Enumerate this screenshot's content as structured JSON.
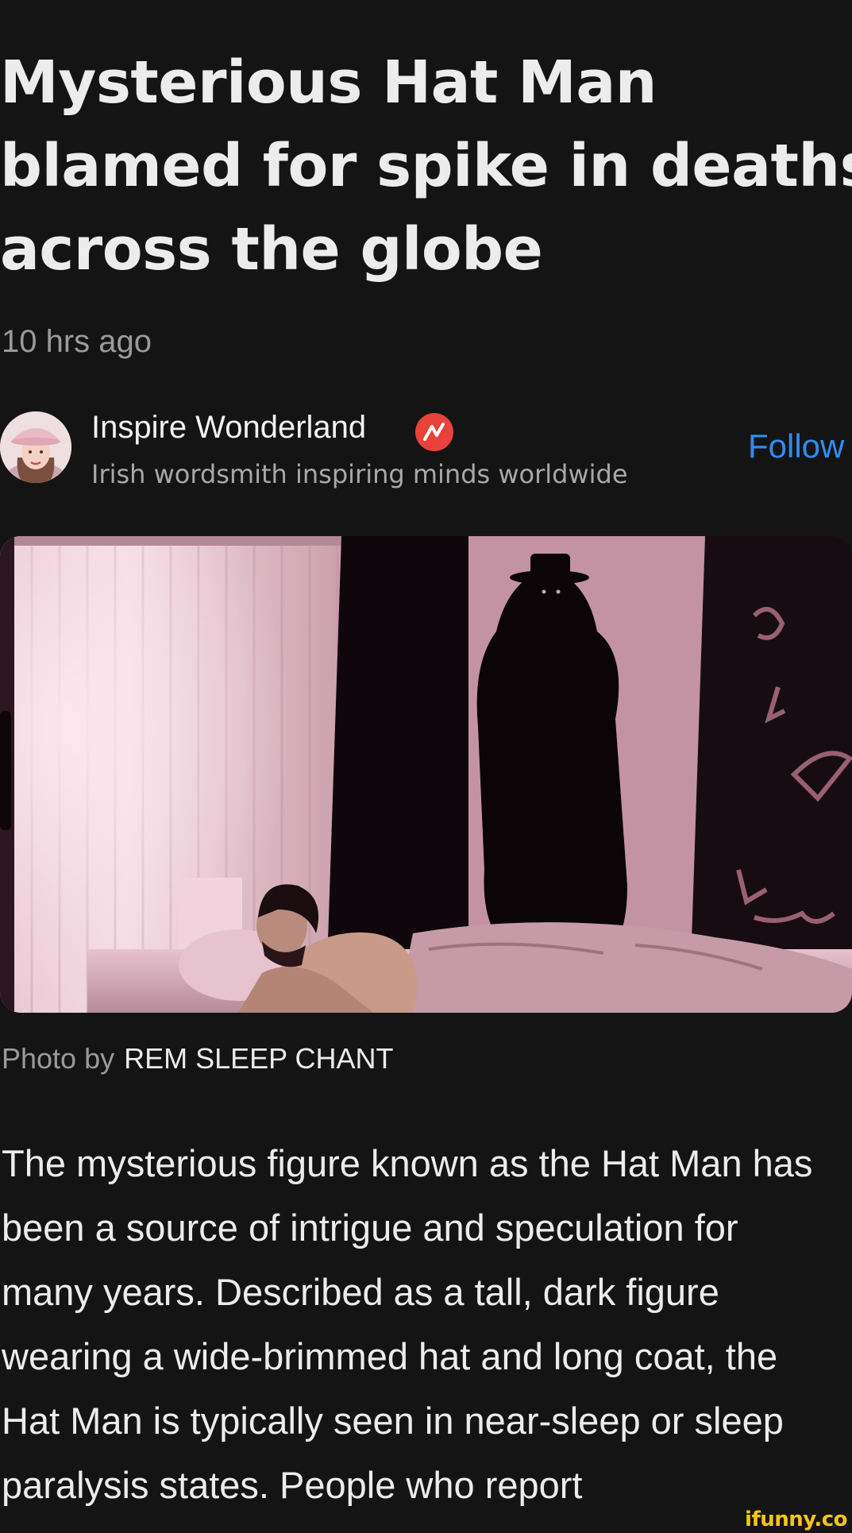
{
  "article": {
    "headline_lines": [
      "Mysterious Hat Man",
      "blamed for spike in deaths",
      "across the globe"
    ],
    "timestamp": "10 hrs ago"
  },
  "author": {
    "name": "Inspire Wonderland",
    "tagline": "Irish wordsmith inspiring minds worldwide",
    "follow_label": "Follow",
    "badge_icon": "verified-badge-icon",
    "badge_color": "#e8423a"
  },
  "photo": {
    "credit_label": "Photo by",
    "credit_name": "REM SLEEP CHANT"
  },
  "body": {
    "lines": [
      "The mysterious figure known as the Hat Man has",
      "been a source of intrigue and speculation for",
      "many years. Described as a tall, dark figure",
      "wearing a wide-brimmed hat and long coat, the",
      "Hat Man is typically seen in near-sleep or sleep",
      "paralysis states. People who report"
    ]
  },
  "watermark": "ifunny.co",
  "colors": {
    "background": "#141414",
    "accent_link": "#2f8df5",
    "watermark": "#f5c518"
  }
}
